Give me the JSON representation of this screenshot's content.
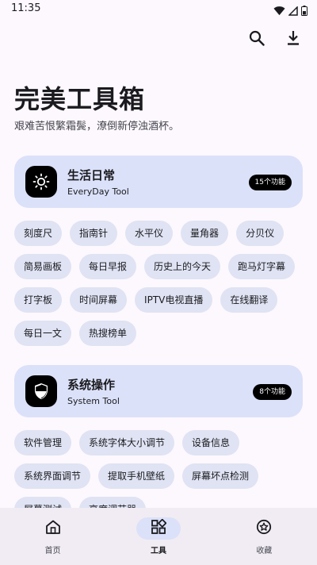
{
  "status_bar": {
    "time": "11:35"
  },
  "hero": {
    "title": "完美工具箱",
    "subtitle": "艰难苦恨繁霜鬓，潦倒新停浊酒杯。"
  },
  "categories": [
    {
      "name": "生活日常",
      "subtitle": "EveryDay Tool",
      "count": "15个功能",
      "tools": [
        "刻度尺",
        "指南针",
        "水平仪",
        "量角器",
        "分贝仪",
        "简易画板",
        "每日早报",
        "历史上的今天",
        "跑马灯字幕",
        "打字板",
        "时间屏幕",
        "IPTV电视直播",
        "在线翻译",
        "每日一文",
        "热搜榜单"
      ]
    },
    {
      "name": "系统操作",
      "subtitle": "System Tool",
      "count": "8个功能",
      "tools": [
        "软件管理",
        "系统字体大小调节",
        "设备信息",
        "系统界面调节",
        "提取手机壁纸",
        "屏幕坏点检测",
        "屏幕测试",
        "亮度调节器"
      ]
    }
  ],
  "bottom_nav": {
    "items": [
      {
        "label": "首页",
        "icon": "home-icon"
      },
      {
        "label": "工具",
        "icon": "apps-icon"
      },
      {
        "label": "收藏",
        "icon": "star-circle-icon"
      }
    ],
    "active_index": 1
  },
  "colors": {
    "background": "#fdf8fd",
    "card": "#dbe1f9",
    "chip": "#dfe3f3",
    "nav_bar": "#f1ecf3"
  }
}
